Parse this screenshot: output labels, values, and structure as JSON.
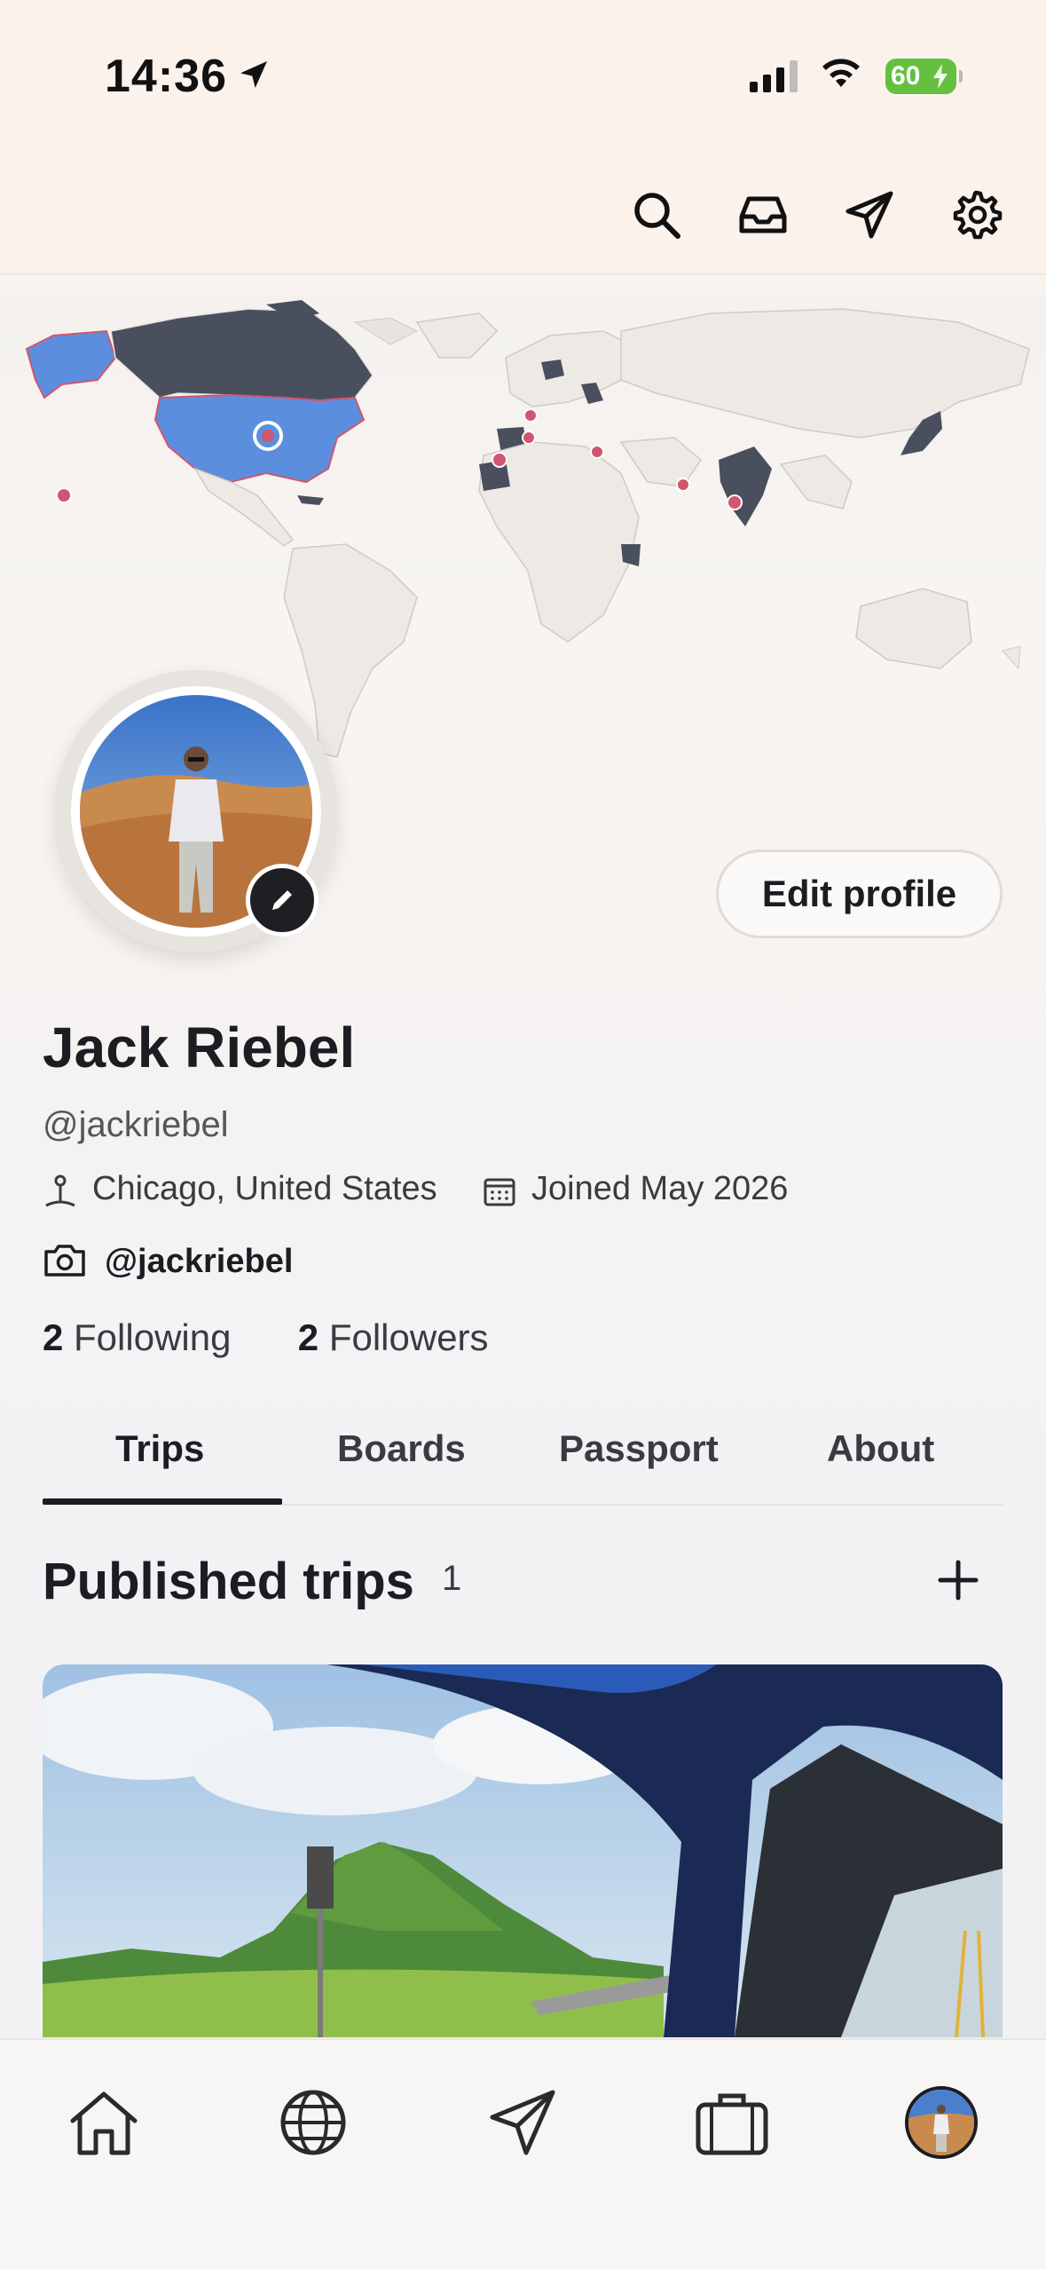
{
  "status_bar": {
    "time": "14:36",
    "battery": "60"
  },
  "top_bar": {
    "icons": [
      "search-icon",
      "inbox-icon",
      "send-icon",
      "gear-icon"
    ]
  },
  "profile": {
    "name": "Jack Riebel",
    "handle": "@jackriebel",
    "location": "Chicago, United States",
    "joined": "Joined May 2026",
    "instagram": "@jackriebel",
    "following_count": "2",
    "following_label": "Following",
    "followers_count": "2",
    "followers_label": "Followers",
    "edit_button": "Edit profile"
  },
  "tabs": [
    {
      "label": "Trips",
      "active": true
    },
    {
      "label": "Boards",
      "active": false
    },
    {
      "label": "Passport",
      "active": false
    },
    {
      "label": "About",
      "active": false
    }
  ],
  "published": {
    "title": "Published trips",
    "count": "1"
  },
  "bottom_nav": {
    "items": [
      "home-icon",
      "globe-icon",
      "send-icon",
      "briefcase-icon",
      "profile-avatar"
    ]
  },
  "colors": {
    "accent_dark": "#1c1c22",
    "visited_country": "#4a4f5e",
    "home_country": "#5b8fde",
    "pin": "#d0566f",
    "background": "#fbf4ef"
  }
}
